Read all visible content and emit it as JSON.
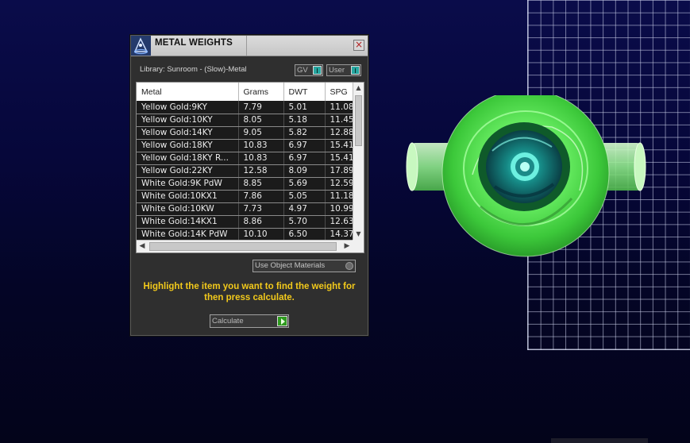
{
  "dialog": {
    "title": "METAL WEIGHTS",
    "library_label": "Library: Sunroom - (Slow)-Metal",
    "gv_combo": "GV",
    "user_combo": "User",
    "use_materials_label": "Use Object Materials",
    "hint_text": "Highlight the item you want to find the weight for then press calculate.",
    "calculate_label": "Calculate",
    "close_glyph": "×"
  },
  "table": {
    "headers": [
      "Metal",
      "Grams",
      "DWT",
      "SPG"
    ],
    "rows": [
      [
        "Yellow Gold:9KY",
        "7.79",
        "5.01",
        "11.08"
      ],
      [
        "Yellow Gold:10KY",
        "8.05",
        "5.18",
        "11.45"
      ],
      [
        "Yellow Gold:14KY",
        "9.05",
        "5.82",
        "12.88"
      ],
      [
        "Yellow Gold:18KY",
        "10.83",
        "6.97",
        "15.41"
      ],
      [
        "Yellow Gold:18KY R...",
        "10.83",
        "6.97",
        "15.41"
      ],
      [
        "Yellow Gold:22KY",
        "12.58",
        "8.09",
        "17.89"
      ],
      [
        "White Gold:9K PdW",
        "8.85",
        "5.69",
        "12.59"
      ],
      [
        "White Gold:10KX1",
        "7.86",
        "5.05",
        "11.18"
      ],
      [
        "White Gold:10KW",
        "7.73",
        "4.97",
        "10.99"
      ],
      [
        "White Gold:14KX1",
        "8.86",
        "5.70",
        "12.63"
      ],
      [
        "White Gold:14K PdW",
        "10.10",
        "6.50",
        "14.37"
      ]
    ]
  },
  "icons": {
    "app": "metal-weights-app-icon",
    "close": "close-icon",
    "scroll_up": "▲",
    "scroll_down": "▼",
    "scroll_left": "◀",
    "scroll_right": "▶"
  },
  "colors": {
    "hint": "#f2c91b",
    "model_green": "#6df56a",
    "model_teal": "#1fb5a8",
    "calc_go": "#2e9a1e"
  }
}
